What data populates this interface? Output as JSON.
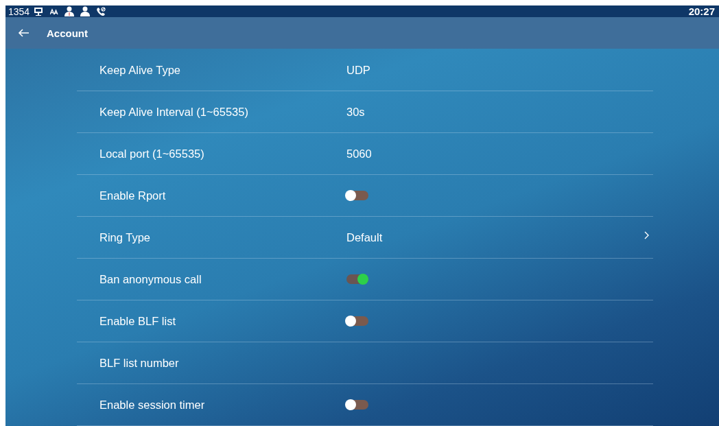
{
  "status_bar": {
    "number": "1354",
    "time": "20:27"
  },
  "header": {
    "title": "Account"
  },
  "settings": [
    {
      "kind": "value",
      "label": "Keep Alive Type",
      "value": "UDP"
    },
    {
      "kind": "value",
      "label": "Keep Alive Interval (1~65535)",
      "value": "30s"
    },
    {
      "kind": "value",
      "label": "Local port (1~65535)",
      "value": "5060"
    },
    {
      "kind": "toggle",
      "label": "Enable Rport",
      "on": false
    },
    {
      "kind": "link",
      "label": "Ring Type",
      "value": "Default"
    },
    {
      "kind": "toggle",
      "label": "Ban anonymous call",
      "on": true
    },
    {
      "kind": "toggle",
      "label": "Enable BLF list",
      "on": false
    },
    {
      "kind": "value",
      "label": "BLF list number"
    },
    {
      "kind": "toggle",
      "label": "Enable session timer",
      "on": false
    }
  ]
}
